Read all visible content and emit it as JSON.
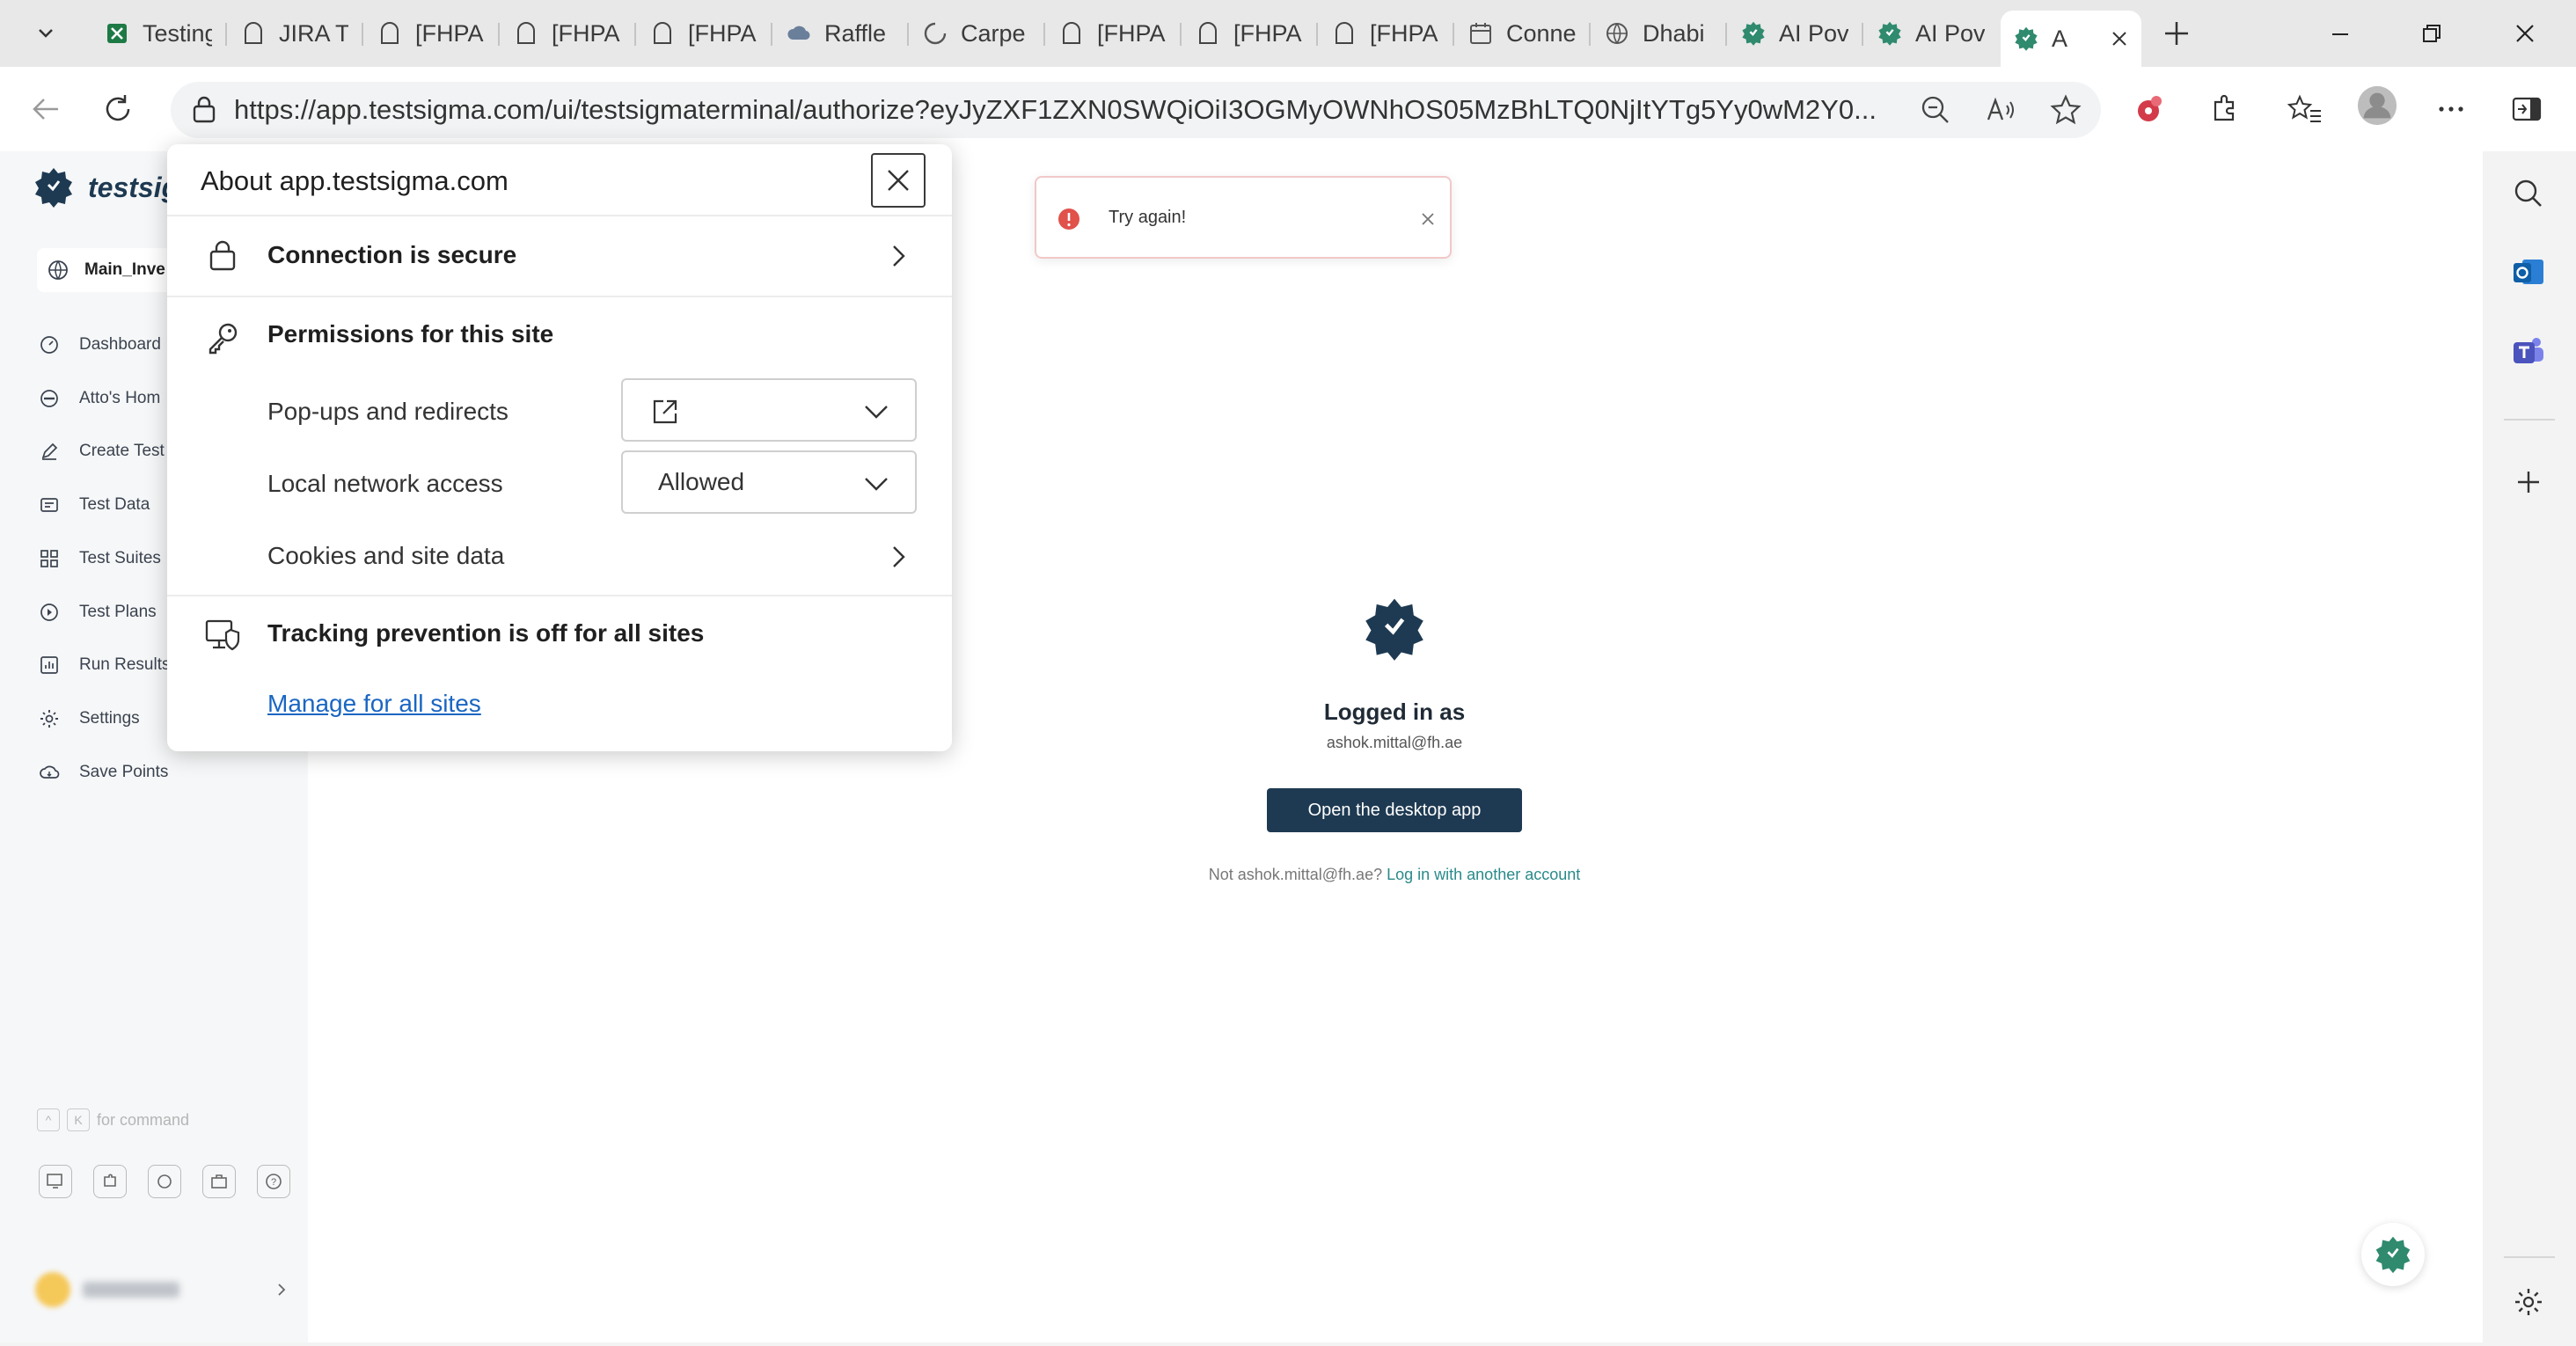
{
  "tabs": [
    {
      "label": "Testing",
      "icon": "excel-icon"
    },
    {
      "label": "JIRA Ti",
      "icon": "jira-icon"
    },
    {
      "label": "[FHPA",
      "icon": "jira-icon"
    },
    {
      "label": "[FHPA",
      "icon": "jira-icon"
    },
    {
      "label": "[FHPA",
      "icon": "jira-icon"
    },
    {
      "label": "Raffle",
      "icon": "cloud-icon"
    },
    {
      "label": "Carpe",
      "icon": "loading-icon"
    },
    {
      "label": "[FHPA",
      "icon": "jira-icon"
    },
    {
      "label": "[FHPA",
      "icon": "jira-icon"
    },
    {
      "label": "[FHPA",
      "icon": "jira-icon"
    },
    {
      "label": "Conne",
      "icon": "calendar-icon"
    },
    {
      "label": "Dhabi",
      "icon": "globe-icon"
    },
    {
      "label": "AI Pov",
      "icon": "testsigma-icon"
    },
    {
      "label": "AI Pov",
      "icon": "testsigma-icon"
    },
    {
      "label": "A",
      "icon": "testsigma-icon"
    }
  ],
  "address_bar": {
    "url": "https://app.testsigma.com/ui/testsigmaterminal/authorize?eyJyZXF1ZXN0SWQiOiI3OGMyOWNhOS05MzBhLTQ0NjItYTg5Yy0wM2Y0..."
  },
  "site_popup": {
    "title": "About app.testsigma.com",
    "connection_label": "Connection is secure",
    "permissions_label": "Permissions for this site",
    "popups_label": "Pop-ups and redirects",
    "local_network_label": "Local network access",
    "local_network_value": "Allowed",
    "cookies_label": "Cookies and site data",
    "tracking_label": "Tracking prevention is off for all sites",
    "manage_link": "Manage for all sites"
  },
  "app": {
    "brand": "testsig",
    "workspace": "Main_Inve",
    "nav": [
      {
        "label": "Dashboard",
        "icon": "dashboard-icon"
      },
      {
        "label": "Atto's Hom",
        "icon": "atto-icon"
      },
      {
        "label": "Create Test",
        "icon": "pencil-icon"
      },
      {
        "label": "Test Data",
        "icon": "data-icon"
      },
      {
        "label": "Test Suites",
        "icon": "grid-icon"
      },
      {
        "label": "Test Plans",
        "icon": "plan-icon"
      },
      {
        "label": "Run Results",
        "icon": "chart-icon"
      },
      {
        "label": "Settings",
        "icon": "gear-icon"
      },
      {
        "label": "Save Points",
        "icon": "cloud-save-icon"
      }
    ],
    "command_hint": "for command"
  },
  "toast": {
    "message": "Try again!"
  },
  "login": {
    "logged_in_label": "Logged in as",
    "email": "ashok.mittal@fh.ae",
    "open_button": "Open the desktop app",
    "not_user_text": "Not ashok.mittal@fh.ae?",
    "switch_link": "Log in with another account"
  },
  "colors": {
    "brand_dark": "#1e3a52",
    "link": "#1a66c2",
    "error": "#e0524a",
    "teal_link": "#2a8a8a"
  }
}
